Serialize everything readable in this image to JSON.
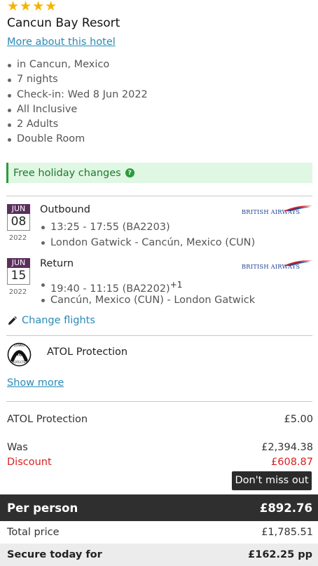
{
  "hotel": {
    "stars": 4,
    "name": "Cancun Bay Resort",
    "more_link": "More about this hotel",
    "details": [
      "in Cancun, Mexico",
      "7 nights",
      "Check-in: Wed 8 Jun 2022",
      "All Inclusive",
      "2 Adults",
      "Double Room"
    ],
    "free_changes": "Free holiday changes"
  },
  "flights": {
    "outbound": {
      "month": "JUN",
      "day": "08",
      "year": "2022",
      "title": "Outbound",
      "airline": "BRITISH AIRWAYS",
      "times": "13:25 - 17:55 (BA2203)",
      "route": "London Gatwick - Cancún, Mexico (CUN)"
    },
    "return": {
      "month": "JUN",
      "day": "15",
      "year": "2022",
      "title": "Return",
      "airline": "BRITISH AIRWAYS",
      "times": "19:40 - 11:15 (BA2202)",
      "day_offset": "+1",
      "route": "Cancún, Mexico (CUN) - London Gatwick"
    },
    "change_label": "Change flights"
  },
  "atol": {
    "title": "ATOL Protection",
    "badge_text": "PROTECTED",
    "badge_number": "10960",
    "badge_word": "ATOL",
    "show_more": "Show more"
  },
  "pricing": {
    "atol_label": "ATOL Protection",
    "atol_value": "£5.00",
    "was_label": "Was",
    "was_value": "£2,394.38",
    "discount_label": "Discount",
    "discount_value": "£608.87",
    "dont_miss": "Don't miss out",
    "per_person_label": "Per person",
    "per_person_value": "£892.76",
    "total_label": "Total price",
    "total_value": "£1,785.51",
    "secure_label": "Secure today for",
    "secure_value": "£162.25 pp"
  },
  "colors": {
    "link": "#2a8ab8",
    "star": "#f5b400",
    "calendar": "#5b2f5c",
    "success": "#2a9c3a",
    "discount": "#d81f1f",
    "dark_bar": "#2f2f2f"
  }
}
